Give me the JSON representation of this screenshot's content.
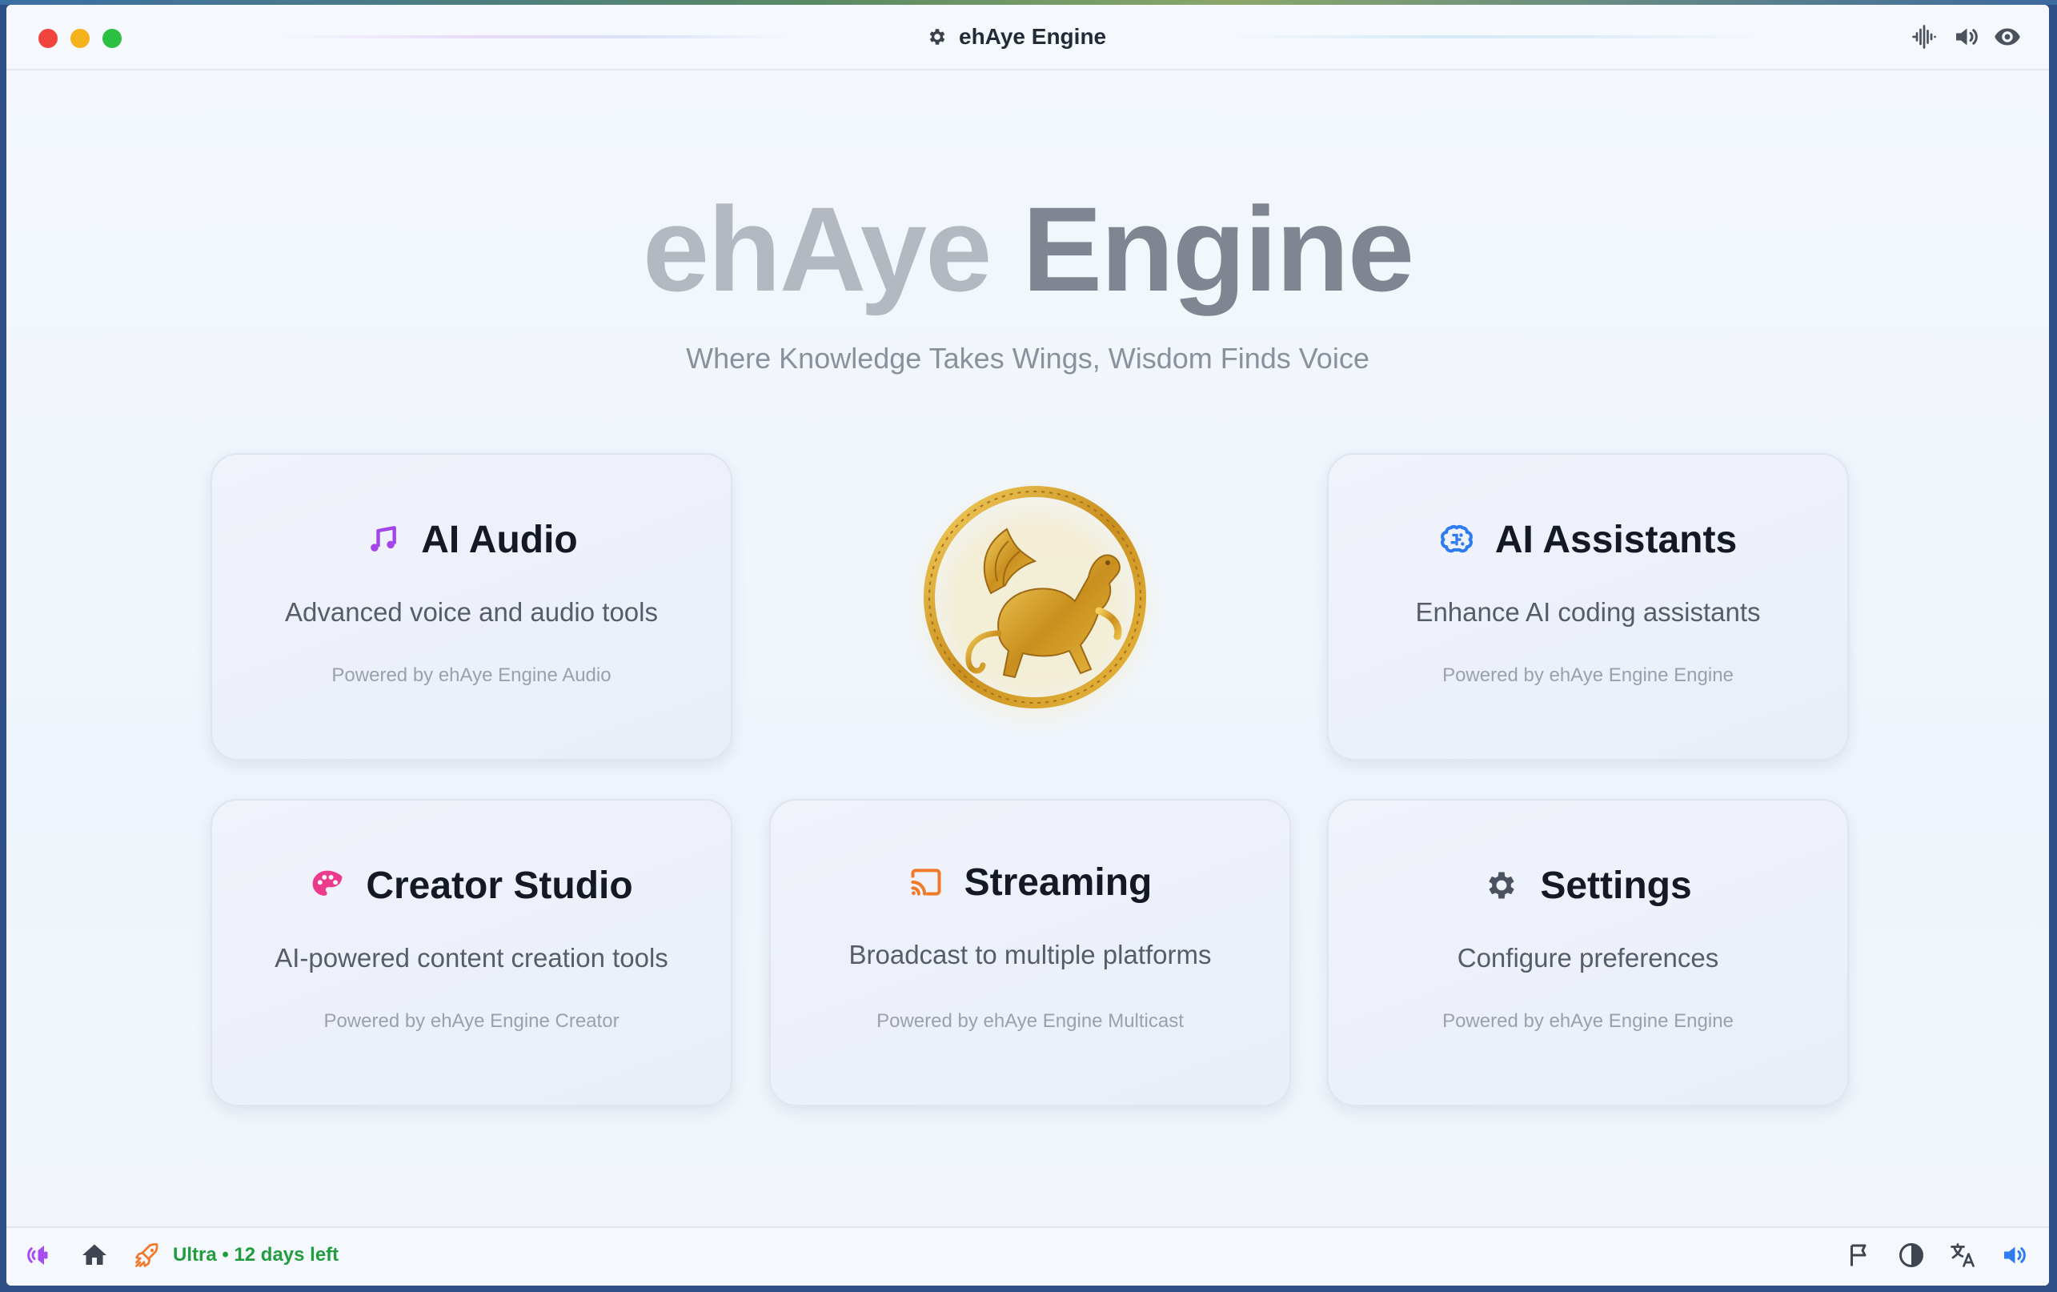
{
  "window": {
    "title": "ehAye Engine",
    "title_icon": "gear-icon",
    "toolbar_icons": [
      "waveform-icon",
      "speaker-icon",
      "eye-icon"
    ]
  },
  "hero": {
    "title_part1": "ehAye",
    "title_part2": "Engine",
    "tagline": "Where Knowledge Takes Wings, Wisdom Finds Voice"
  },
  "cards": [
    {
      "id": "ai-audio",
      "icon": "music-note-icon",
      "icon_color": "#a345e8",
      "title": "AI Audio",
      "description": "Advanced voice and audio tools",
      "powered_by": "Powered by ehAye Engine Audio"
    },
    {
      "id": "ai-assistants",
      "icon": "brain-icon",
      "icon_color": "#2f7cf0",
      "title": "AI Assistants",
      "description": "Enhance AI coding assistants",
      "powered_by": "Powered by ehAye Engine Engine"
    },
    {
      "id": "creator-studio",
      "icon": "palette-icon",
      "icon_color": "#ec3a8c",
      "title": "Creator Studio",
      "description": "AI-powered content creation tools",
      "powered_by": "Powered by ehAye Engine Creator"
    },
    {
      "id": "streaming",
      "icon": "cast-icon",
      "icon_color": "#f07a2a",
      "title": "Streaming",
      "description": "Broadcast to multiple platforms",
      "powered_by": "Powered by ehAye Engine Multicast"
    },
    {
      "id": "settings",
      "icon": "gear-icon",
      "icon_color": "#4b5260",
      "title": "Settings",
      "description": "Configure preferences",
      "powered_by": "Powered by ehAye Engine Engine"
    }
  ],
  "emblem": {
    "icon": "griffin-emblem-icon",
    "color": "#d4a12a"
  },
  "statusbar": {
    "left_icons": [
      "voice-icon",
      "home-icon",
      "rocket-icon"
    ],
    "plan_status": "Ultra • 12 days left",
    "plan_color": "#1f9d3f",
    "right_icons": [
      "flag-icon",
      "contrast-icon",
      "translate-icon",
      "volume-icon"
    ]
  },
  "colors": {
    "accent_blue": "#2f7cf0",
    "voice_purple": "#a64cf0"
  }
}
